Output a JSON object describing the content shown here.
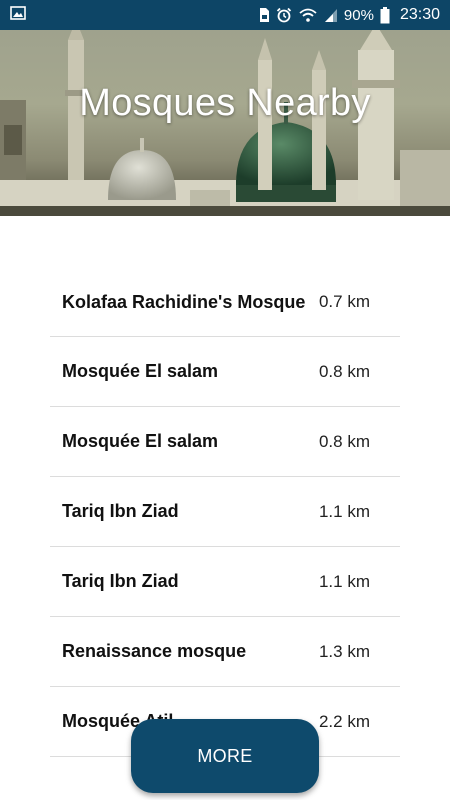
{
  "status_bar": {
    "battery_percent": "90%",
    "time": "23:30",
    "icons": [
      "image-icon",
      "sim-icon",
      "alarm-icon",
      "wifi-icon",
      "signal-icon",
      "battery-icon"
    ]
  },
  "header": {
    "title": "Mosques Nearby"
  },
  "mosques": [
    {
      "name": "Kolafaa Rachidine's Mosque",
      "distance": "0.7 km"
    },
    {
      "name": "Mosquée El salam",
      "distance": "0.8 km"
    },
    {
      "name": "Mosquée El salam",
      "distance": "0.8 km"
    },
    {
      "name": "Tariq Ibn Ziad",
      "distance": "1.1 km"
    },
    {
      "name": "Tariq Ibn Ziad",
      "distance": "1.1 km"
    },
    {
      "name": "Renaissance mosque",
      "distance": "1.3 km"
    },
    {
      "name": "Mosquée Atil",
      "distance": "2.2 km"
    }
  ],
  "actions": {
    "more_label": "MORE"
  },
  "colors": {
    "primary": "#0e4a6c",
    "status_bar": "#0d4566"
  }
}
